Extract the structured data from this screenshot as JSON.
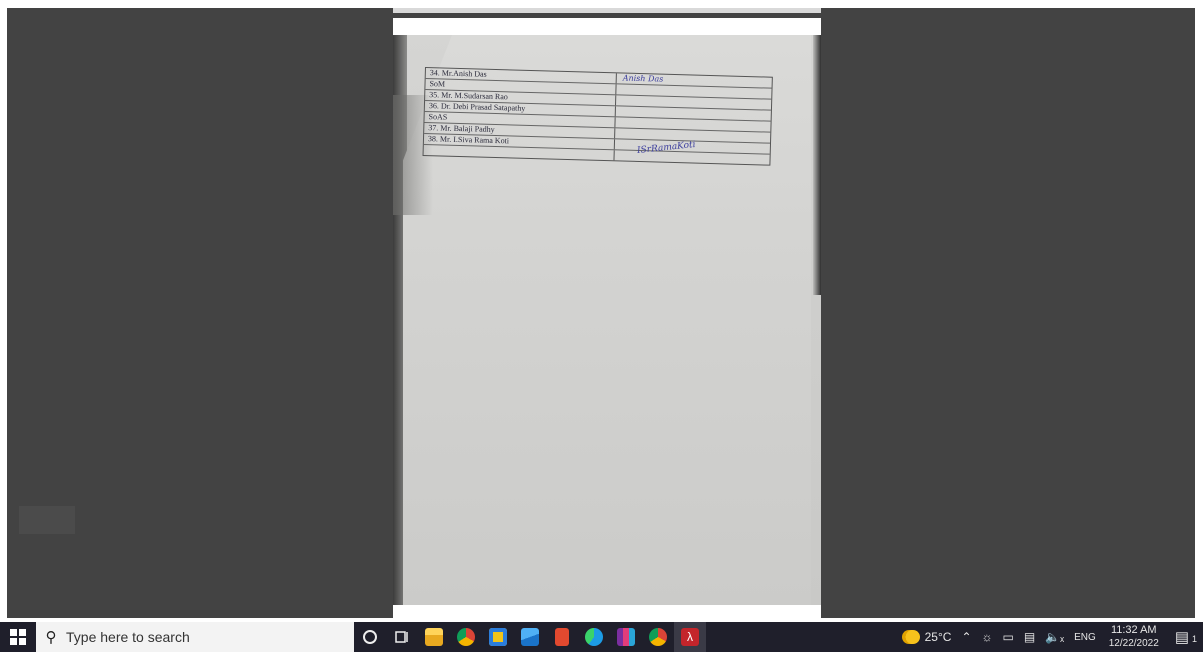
{
  "document": {
    "rows": [
      {
        "name": "34. Mr.Anish Das",
        "signature": "Anish Das"
      },
      {
        "name": "SoM",
        "signature": ""
      },
      {
        "name": "35. Mr. M.Sudarsan Rao",
        "signature": ""
      },
      {
        "name": "36. Dr. Debi Prasad Satapathy",
        "signature": ""
      },
      {
        "name": "SoAS",
        "signature": ""
      },
      {
        "name": "37. Mr. Balaji Padhy",
        "signature": ""
      },
      {
        "name": "38. Mr. I.Siva Rama Koti",
        "signature": ""
      },
      {
        "name": "",
        "signature": ""
      }
    ],
    "signature_lower": "ISrRamaKoti"
  },
  "taskbar": {
    "search_placeholder": "Type here to search",
    "weather": "25°C",
    "language": "ENG",
    "time": "11:32 AM",
    "date": "12/22/2022",
    "notification_count": "1"
  },
  "colors": {
    "taskbar": "#1f1f2b",
    "viewer_bg": "#434343",
    "pdf_red": "#c4252b"
  }
}
